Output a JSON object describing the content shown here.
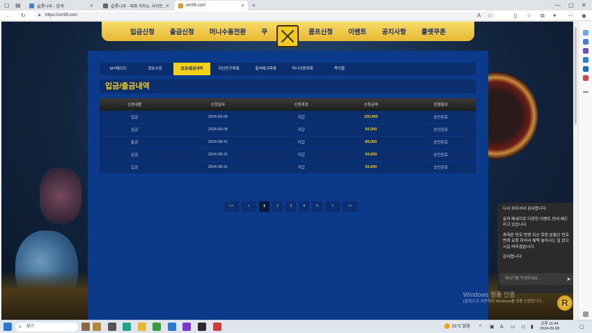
{
  "browser": {
    "tabs": [
      {
        "title": "슬롯나라 - 검색",
        "active": false
      },
      {
        "title": "슬롯나라 - 제휴 카지노 사이트 ...",
        "active": false
      },
      {
        "title": "snr99.com",
        "active": true
      }
    ],
    "url": "https://snr99.com"
  },
  "site": {
    "nav": [
      "입금신청",
      "출금신청",
      "머니수동전환",
      "쿠",
      "콤프신청",
      "이벤트",
      "공지사항",
      "룰렛쿠폰"
    ],
    "subtabs": [
      "MY페이지",
      "정보수정",
      "입금/출금내역",
      "지인친구목록",
      "출석체크목록",
      "머니이동목록",
      "쪽지함"
    ],
    "active_subtab": "입금/출금내역",
    "section_title": "입금/출금내역",
    "table": {
      "headers": [
        "신청내용",
        "신청일자",
        "신청계정",
        "신청금액",
        "진행결과"
      ],
      "rows": [
        [
          "입금",
          "2024-09-08",
          "지갑",
          "100,000",
          "승인완료"
        ],
        [
          "입금",
          "2024-09-08",
          "지갑",
          "50,000",
          "승인완료"
        ],
        [
          "출금",
          "2024-08-31",
          "지갑",
          "80,000",
          "승인완료"
        ],
        [
          "입금",
          "2024-08-31",
          "지갑",
          "50,000",
          "승인완료"
        ],
        [
          "입금",
          "2024-08-31",
          "지갑",
          "50,000",
          "승인완료"
        ]
      ]
    },
    "pager": {
      "first": "<<",
      "prev": "<",
      "pages": [
        "1",
        "2",
        "3",
        "4",
        "5"
      ],
      "current": "1",
      "next": ">",
      "last": ">>"
    }
  },
  "chat": {
    "messages": [
      "다시 와주셔서 감사합니다.",
      "문자 메세지로 다양한 이벤트 안내 해드리고 있습니다",
      "휴대폰 번호 변경 되신 회원 분들은 번호 변경 요청 하셔서 혜택 놓치시는 일 없으시길 바라겠습니다.",
      "감사합니다."
    ],
    "input_placeholder": "메시지를 작성하세요..."
  },
  "watermark": {
    "line1": "Windows 정품 인증",
    "line2": "[설정]으로 이동하여 Windows를 정품 인증합니다."
  },
  "taskbar": {
    "search_label": "찾기",
    "weather": "31°C 맑음",
    "time": "오후 11:44",
    "date": "2024-09-08"
  }
}
